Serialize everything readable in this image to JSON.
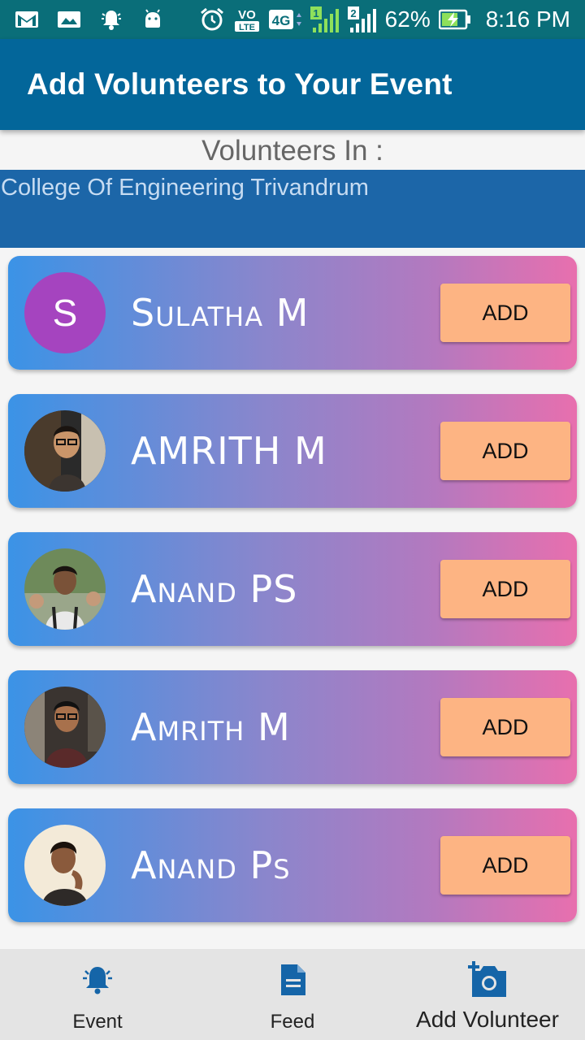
{
  "status_bar": {
    "battery": "62%",
    "time": "8:16 PM",
    "network": "4G",
    "volte": "VO LTE",
    "sim1": "1",
    "sim2": "2",
    "icons": [
      "gmail-icon",
      "gallery-icon",
      "notification-bell-icon",
      "android-icon",
      "alarm-icon",
      "volte-icon",
      "4g-icon",
      "signal-sim1-icon",
      "signal-sim2-icon",
      "battery-charging-icon"
    ]
  },
  "app_bar": {
    "title": "Add Volunteers to Your Event"
  },
  "section": {
    "heading": "Volunteers In :",
    "college": "College Of Engineering Trivandrum"
  },
  "volunteers": [
    {
      "name": "Sulatha M",
      "initial": "S",
      "avatar": "letter",
      "action": "ADD"
    },
    {
      "name": "AMRITH M",
      "avatar": "photo",
      "action": "ADD"
    },
    {
      "name": "Anand PS",
      "avatar": "photo",
      "action": "ADD"
    },
    {
      "name": "Amrith M",
      "avatar": "photo",
      "action": "ADD"
    },
    {
      "name": "Anand Ps",
      "avatar": "photo",
      "action": "ADD"
    }
  ],
  "bottom_nav": [
    {
      "label": "Event",
      "icon": "bell-icon"
    },
    {
      "label": "Feed",
      "icon": "document-icon"
    },
    {
      "label": "Add Volunteer",
      "icon": "add-photo-icon",
      "active": true
    }
  ],
  "colors": {
    "status_bar": "#0a6e79",
    "app_bar": "#03669a",
    "college_bar": "#1c66a8",
    "card_gradient_start": "#3b93e6",
    "card_gradient_end": "#e86fae",
    "add_button": "#fdb483",
    "nav_icon": "#1565a8"
  }
}
